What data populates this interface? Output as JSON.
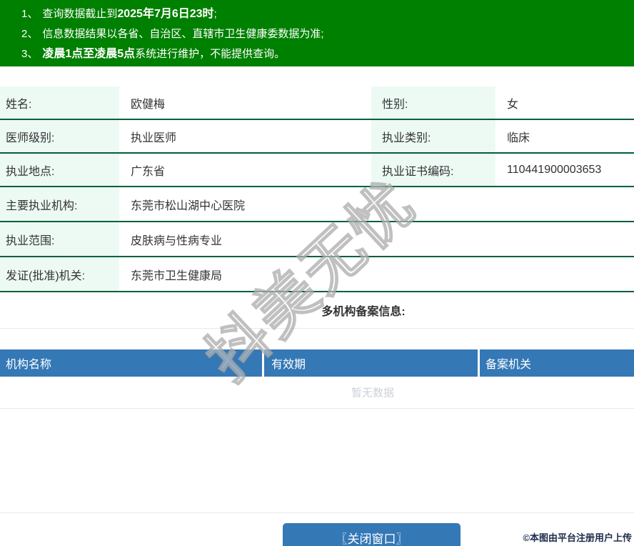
{
  "notice": {
    "lines": [
      {
        "num": "1、",
        "pre": "查询数据截止到",
        "bold": "2025年7月6日23时",
        "post": ";"
      },
      {
        "num": "2、",
        "pre": "信息数据结果以各省、自治区、直辖市卫生健康委数据为准;",
        "bold": "",
        "post": ""
      },
      {
        "num": "3、",
        "pre": "",
        "bold": "凌晨1点至凌晨5点",
        "post": "系统进行维护，不能提供查询。"
      }
    ]
  },
  "profile": {
    "row1": {
      "label1": "姓名:",
      "value1": "欧健梅",
      "label2": "性别:",
      "value2": "女"
    },
    "row2": {
      "label1": "医师级别:",
      "value1": "执业医师",
      "label2": "执业类别:",
      "value2": "临床"
    },
    "row3": {
      "label1": "执业地点:",
      "value1": "广东省",
      "label2": "执业证书编码:",
      "value2": "110441900003653"
    },
    "row4": {
      "label": "主要执业机构:",
      "value": "东莞市松山湖中心医院"
    },
    "row5": {
      "label": "执业范围:",
      "value": "皮肤病与性病专业"
    },
    "row6": {
      "label": "发证(批准)机关:",
      "value": "东莞市卫生健康局"
    }
  },
  "filing": {
    "section_title": "多机构备案信息:",
    "headers": [
      "机构名称",
      "有效期",
      "备案机关"
    ],
    "empty_text": "暂无数据"
  },
  "footer": {
    "close_button": "〖关闭窗口〗",
    "caption": "©本图由平台注册用户上传"
  },
  "watermark": "抖美无忧",
  "colors": {
    "banner_green": "#008000",
    "separator_green": "#00603a",
    "label_bg": "#edfaf4",
    "accent_blue": "#3478b6",
    "empty_text_gray": "#ccd0d7"
  }
}
